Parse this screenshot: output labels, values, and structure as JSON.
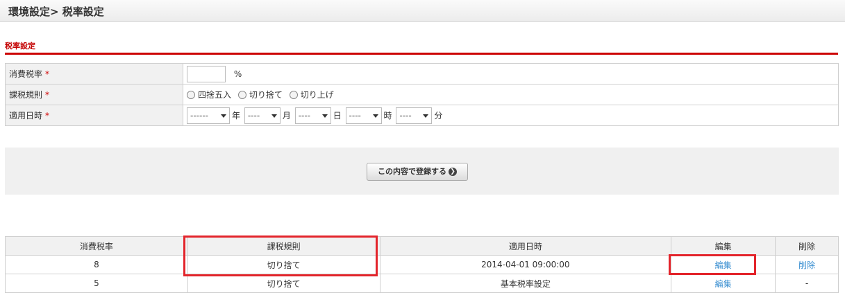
{
  "header": {
    "title": "環境設定> 税率設定"
  },
  "section": {
    "title": "税率設定"
  },
  "form": {
    "rate": {
      "label": "消費税率",
      "required_mark": "*",
      "value": "",
      "unit": "%"
    },
    "rule": {
      "label": "課税規則",
      "required_mark": "*",
      "options": [
        "四捨五入",
        "切り捨て",
        "切り上げ"
      ]
    },
    "date": {
      "label": "適用日時",
      "required_mark": "*",
      "year": {
        "value": "------",
        "unit": "年"
      },
      "month": {
        "value": "----",
        "unit": "月"
      },
      "day": {
        "value": "----",
        "unit": "日"
      },
      "hour": {
        "value": "----",
        "unit": "時"
      },
      "minute": {
        "value": "----",
        "unit": "分"
      }
    }
  },
  "submit": {
    "label": "この内容で登録する",
    "icon": "arrow-right-circle-icon"
  },
  "list": {
    "headers": [
      "消費税率",
      "課税規則",
      "適用日時",
      "編集",
      "削除"
    ],
    "rows": [
      {
        "rate": "8",
        "rule": "切り捨て",
        "date": "2014-04-01 09:00:00",
        "edit": "編集",
        "delete": "削除"
      },
      {
        "rate": "5",
        "rule": "切り捨て",
        "date": "基本税率設定",
        "edit": "編集",
        "delete": "-"
      }
    ]
  },
  "colors": {
    "accent": "#cc0000",
    "link": "#3a8fd1",
    "highlight": "#e3242b"
  }
}
